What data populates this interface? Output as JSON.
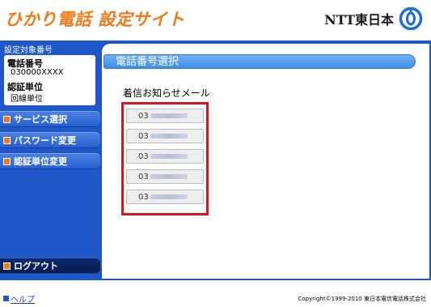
{
  "header": {
    "site_title": "ひかり電話 設定サイト",
    "logo_text": "NTT東日本"
  },
  "sidebar": {
    "info_heading": "設定対象番号",
    "phone_label": "電話番号",
    "phone_value": "030000XXXX",
    "auth_label": "認証単位",
    "auth_value": "回線単位",
    "menu": [
      {
        "label": "サービス選択"
      },
      {
        "label": "パスワード変更"
      },
      {
        "label": "認証単位変更"
      }
    ],
    "logout_label": "ログアウト"
  },
  "content": {
    "title": "電話番号選択",
    "section_label": "着信お知らせメール",
    "numbers": [
      {
        "prefix": "03"
      },
      {
        "prefix": "03"
      },
      {
        "prefix": "03"
      },
      {
        "prefix": "03"
      },
      {
        "prefix": "03"
      }
    ]
  },
  "footer": {
    "help_label": "ヘルプ",
    "copyright": "Copyright©1999-2010 東日本電信電話株式会社"
  },
  "colors": {
    "brand_orange": "#f07a18",
    "nav_blue": "#1e57c8",
    "highlight_red": "#d8141d"
  }
}
